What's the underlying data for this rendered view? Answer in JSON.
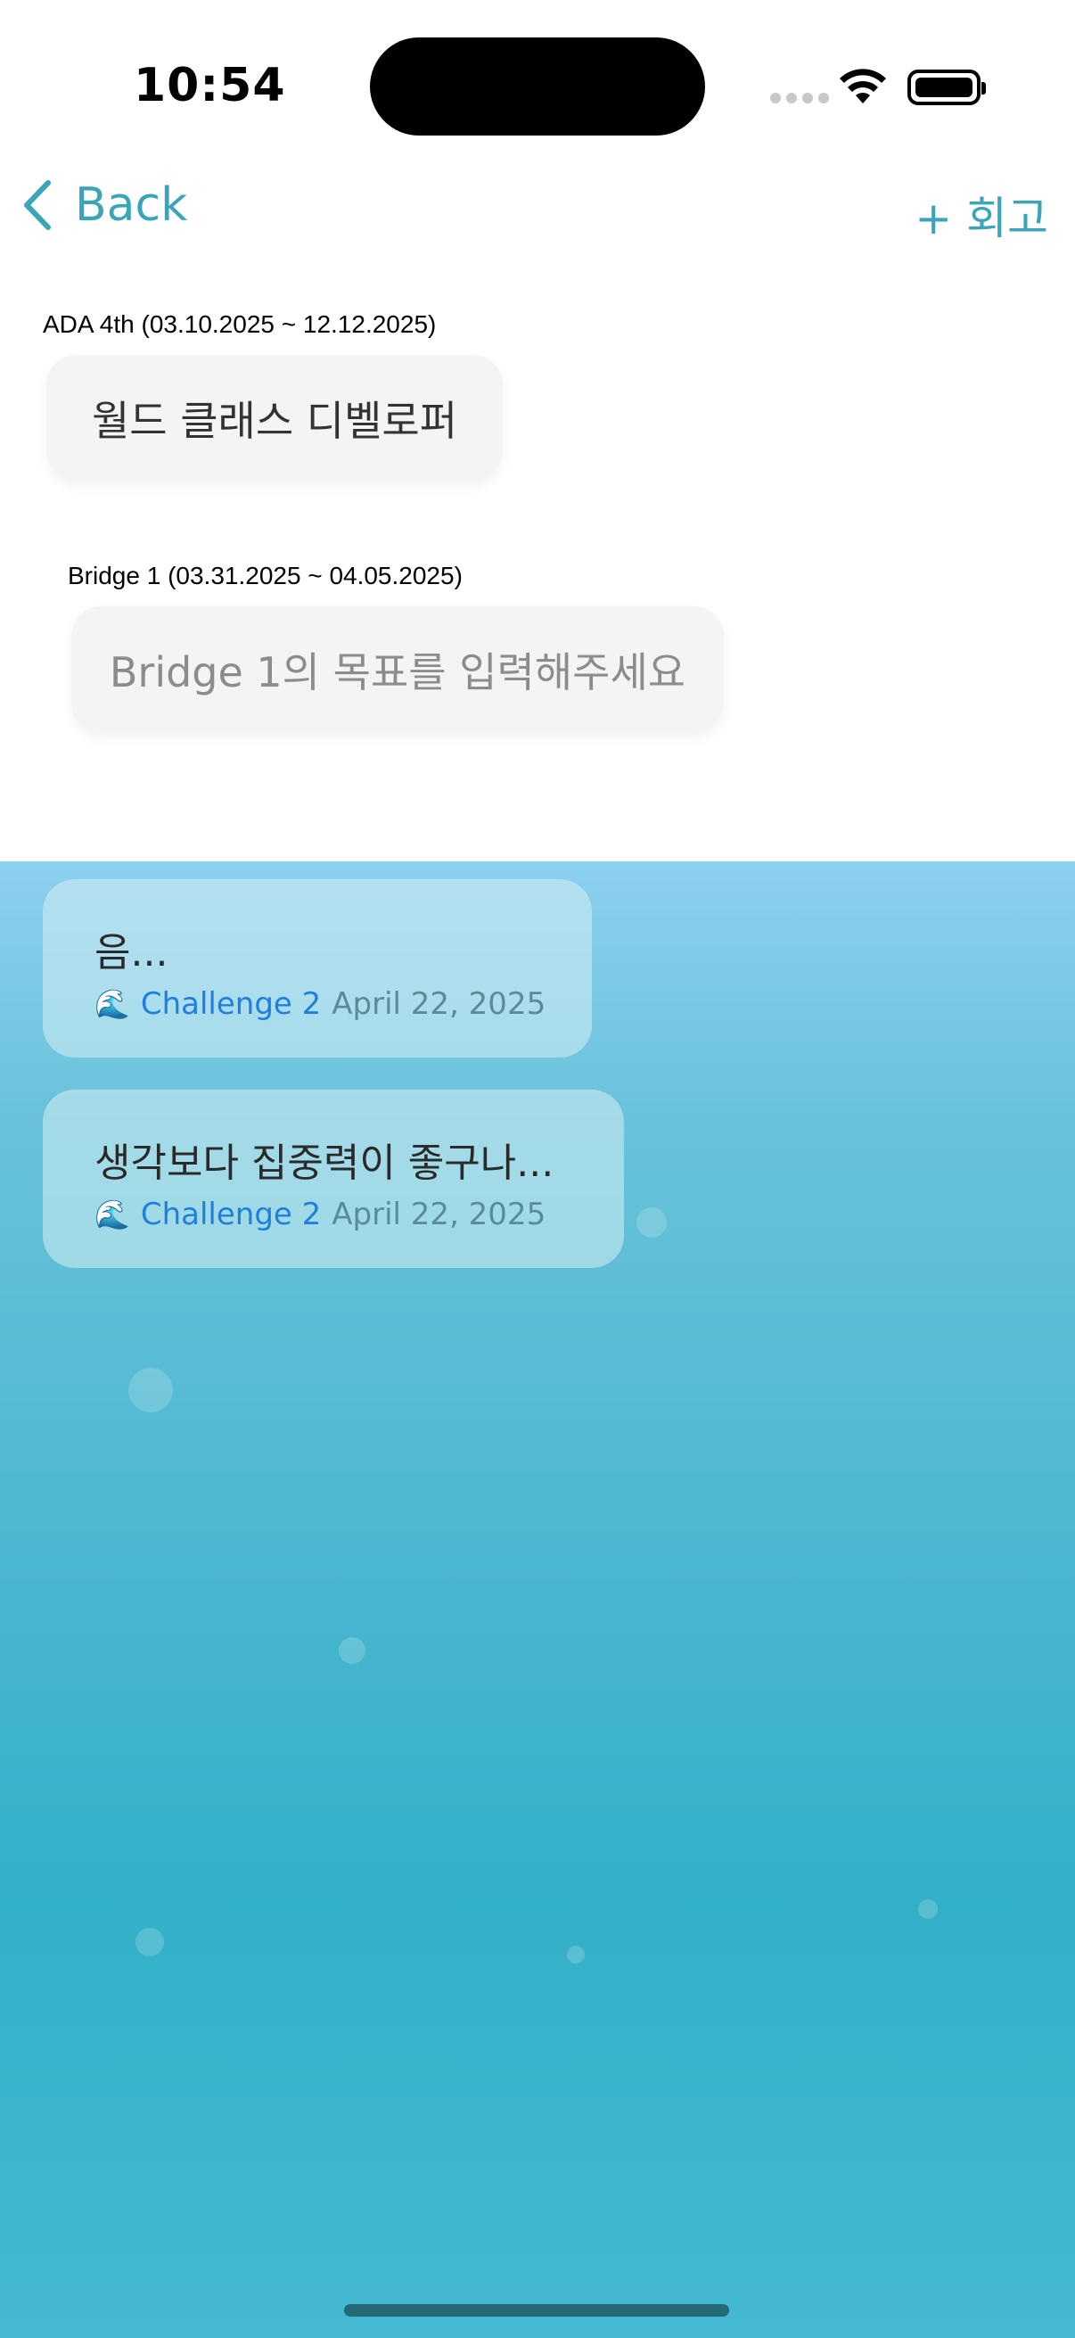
{
  "status": {
    "time": "10:54"
  },
  "nav": {
    "back_label": "Back",
    "add_retro_label": "+ 회고"
  },
  "goals": [
    {
      "label": "ADA 4th (03.10.2025 ~ 12.12.2025)",
      "value": "월드 클래스 디벨로퍼",
      "is_placeholder": false
    },
    {
      "label": "Bridge 1 (03.31.2025 ~ 04.05.2025)",
      "value": "Bridge 1의 목표를 입력해주세요",
      "is_placeholder": true
    }
  ],
  "entries": [
    {
      "title": "음...",
      "icon": "🌊",
      "challenge": "Challenge 2",
      "date": "April 22, 2025"
    },
    {
      "title": "생각보다 집중력이 좋구나...",
      "icon": "🌊",
      "challenge": "Challenge 2",
      "date": "April 22, 2025"
    }
  ],
  "colors": {
    "accent": "#3aa5b8",
    "link": "#1f7fe0",
    "ocean_top": "#8cd0ef",
    "ocean_bottom": "#32b0c8"
  },
  "icons": {
    "back": "chevron-left-icon",
    "wifi": "wifi-icon",
    "battery": "battery-icon",
    "wave": "wave-icon"
  }
}
